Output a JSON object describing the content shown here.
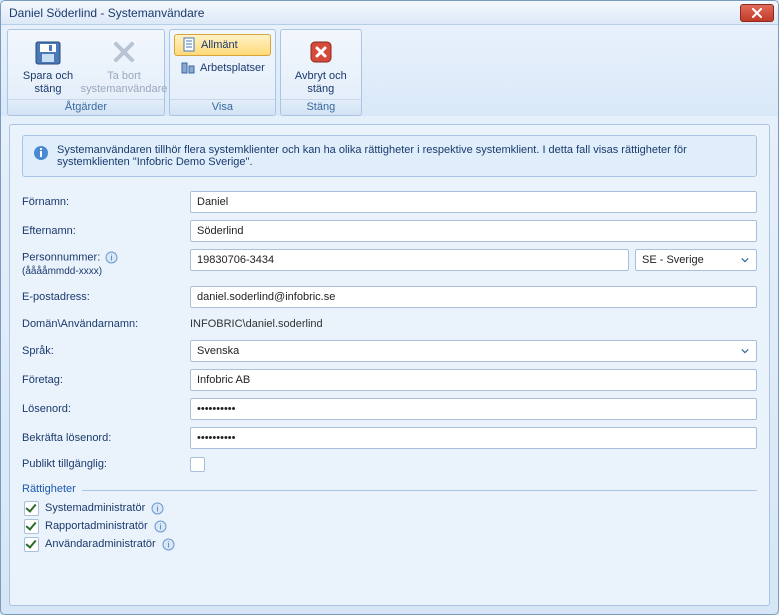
{
  "window": {
    "title": "Daniel Söderlind - Systemanvändare"
  },
  "ribbon": {
    "groups": {
      "actions": {
        "label": "Åtgärder",
        "save": "Spara och\nstäng",
        "remove": "Ta bort\nsystemanvändare"
      },
      "view": {
        "label": "Visa",
        "general": "Allmänt",
        "workplaces": "Arbetsplatser"
      },
      "close": {
        "label": "Stäng",
        "cancel": "Avbryt och\nstäng"
      }
    }
  },
  "info": {
    "text": "Systemanvändaren tillhör flera systemklienter och kan ha olika rättigheter i respektive systemklient. I detta fall visas rättigheter för systemklienten \"Infobric Demo Sverige\"."
  },
  "form": {
    "labels": {
      "firstname": "Förnamn:",
      "lastname": "Efternamn:",
      "personnr": "Personnummer:",
      "personnr_hint": "(ååååmmdd-xxxx)",
      "email": "E-postadress:",
      "domainuser": "Domän\\Användarnamn:",
      "language": "Språk:",
      "company": "Företag:",
      "password": "Lösenord:",
      "confirm": "Bekräfta lösenord:",
      "public": "Publikt tillgänglig:"
    },
    "values": {
      "firstname": "Daniel",
      "lastname": "Söderlind",
      "personnr": "19830706-3434",
      "country": "SE - Sverige",
      "email": "daniel.soderlind@infobric.se",
      "domainuser": "INFOBRIC\\daniel.soderlind",
      "language": "Svenska",
      "company": "Infobric AB",
      "password": "••••••••••",
      "confirm": "••••••••••",
      "public_checked": false
    }
  },
  "permissions": {
    "legend": "Rättigheter",
    "items": [
      {
        "label": "Systemadministratör",
        "checked": true
      },
      {
        "label": "Rapportadministratör",
        "checked": true
      },
      {
        "label": "Användaradministratör",
        "checked": true
      }
    ]
  }
}
